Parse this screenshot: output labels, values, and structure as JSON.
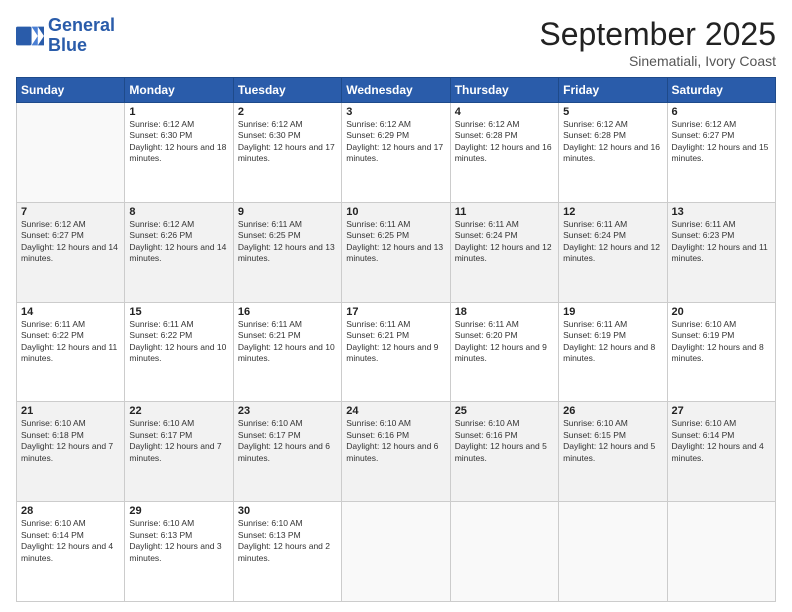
{
  "logo": {
    "line1": "General",
    "line2": "Blue"
  },
  "title": "September 2025",
  "location": "Sinematiali, Ivory Coast",
  "days_header": [
    "Sunday",
    "Monday",
    "Tuesday",
    "Wednesday",
    "Thursday",
    "Friday",
    "Saturday"
  ],
  "weeks": [
    [
      {
        "day": "",
        "sunrise": "",
        "sunset": "",
        "daylight": ""
      },
      {
        "day": "1",
        "sunrise": "Sunrise: 6:12 AM",
        "sunset": "Sunset: 6:30 PM",
        "daylight": "Daylight: 12 hours and 18 minutes."
      },
      {
        "day": "2",
        "sunrise": "Sunrise: 6:12 AM",
        "sunset": "Sunset: 6:30 PM",
        "daylight": "Daylight: 12 hours and 17 minutes."
      },
      {
        "day": "3",
        "sunrise": "Sunrise: 6:12 AM",
        "sunset": "Sunset: 6:29 PM",
        "daylight": "Daylight: 12 hours and 17 minutes."
      },
      {
        "day": "4",
        "sunrise": "Sunrise: 6:12 AM",
        "sunset": "Sunset: 6:28 PM",
        "daylight": "Daylight: 12 hours and 16 minutes."
      },
      {
        "day": "5",
        "sunrise": "Sunrise: 6:12 AM",
        "sunset": "Sunset: 6:28 PM",
        "daylight": "Daylight: 12 hours and 16 minutes."
      },
      {
        "day": "6",
        "sunrise": "Sunrise: 6:12 AM",
        "sunset": "Sunset: 6:27 PM",
        "daylight": "Daylight: 12 hours and 15 minutes."
      }
    ],
    [
      {
        "day": "7",
        "sunrise": "Sunrise: 6:12 AM",
        "sunset": "Sunset: 6:27 PM",
        "daylight": "Daylight: 12 hours and 14 minutes."
      },
      {
        "day": "8",
        "sunrise": "Sunrise: 6:12 AM",
        "sunset": "Sunset: 6:26 PM",
        "daylight": "Daylight: 12 hours and 14 minutes."
      },
      {
        "day": "9",
        "sunrise": "Sunrise: 6:11 AM",
        "sunset": "Sunset: 6:25 PM",
        "daylight": "Daylight: 12 hours and 13 minutes."
      },
      {
        "day": "10",
        "sunrise": "Sunrise: 6:11 AM",
        "sunset": "Sunset: 6:25 PM",
        "daylight": "Daylight: 12 hours and 13 minutes."
      },
      {
        "day": "11",
        "sunrise": "Sunrise: 6:11 AM",
        "sunset": "Sunset: 6:24 PM",
        "daylight": "Daylight: 12 hours and 12 minutes."
      },
      {
        "day": "12",
        "sunrise": "Sunrise: 6:11 AM",
        "sunset": "Sunset: 6:24 PM",
        "daylight": "Daylight: 12 hours and 12 minutes."
      },
      {
        "day": "13",
        "sunrise": "Sunrise: 6:11 AM",
        "sunset": "Sunset: 6:23 PM",
        "daylight": "Daylight: 12 hours and 11 minutes."
      }
    ],
    [
      {
        "day": "14",
        "sunrise": "Sunrise: 6:11 AM",
        "sunset": "Sunset: 6:22 PM",
        "daylight": "Daylight: 12 hours and 11 minutes."
      },
      {
        "day": "15",
        "sunrise": "Sunrise: 6:11 AM",
        "sunset": "Sunset: 6:22 PM",
        "daylight": "Daylight: 12 hours and 10 minutes."
      },
      {
        "day": "16",
        "sunrise": "Sunrise: 6:11 AM",
        "sunset": "Sunset: 6:21 PM",
        "daylight": "Daylight: 12 hours and 10 minutes."
      },
      {
        "day": "17",
        "sunrise": "Sunrise: 6:11 AM",
        "sunset": "Sunset: 6:21 PM",
        "daylight": "Daylight: 12 hours and 9 minutes."
      },
      {
        "day": "18",
        "sunrise": "Sunrise: 6:11 AM",
        "sunset": "Sunset: 6:20 PM",
        "daylight": "Daylight: 12 hours and 9 minutes."
      },
      {
        "day": "19",
        "sunrise": "Sunrise: 6:11 AM",
        "sunset": "Sunset: 6:19 PM",
        "daylight": "Daylight: 12 hours and 8 minutes."
      },
      {
        "day": "20",
        "sunrise": "Sunrise: 6:10 AM",
        "sunset": "Sunset: 6:19 PM",
        "daylight": "Daylight: 12 hours and 8 minutes."
      }
    ],
    [
      {
        "day": "21",
        "sunrise": "Sunrise: 6:10 AM",
        "sunset": "Sunset: 6:18 PM",
        "daylight": "Daylight: 12 hours and 7 minutes."
      },
      {
        "day": "22",
        "sunrise": "Sunrise: 6:10 AM",
        "sunset": "Sunset: 6:17 PM",
        "daylight": "Daylight: 12 hours and 7 minutes."
      },
      {
        "day": "23",
        "sunrise": "Sunrise: 6:10 AM",
        "sunset": "Sunset: 6:17 PM",
        "daylight": "Daylight: 12 hours and 6 minutes."
      },
      {
        "day": "24",
        "sunrise": "Sunrise: 6:10 AM",
        "sunset": "Sunset: 6:16 PM",
        "daylight": "Daylight: 12 hours and 6 minutes."
      },
      {
        "day": "25",
        "sunrise": "Sunrise: 6:10 AM",
        "sunset": "Sunset: 6:16 PM",
        "daylight": "Daylight: 12 hours and 5 minutes."
      },
      {
        "day": "26",
        "sunrise": "Sunrise: 6:10 AM",
        "sunset": "Sunset: 6:15 PM",
        "daylight": "Daylight: 12 hours and 5 minutes."
      },
      {
        "day": "27",
        "sunrise": "Sunrise: 6:10 AM",
        "sunset": "Sunset: 6:14 PM",
        "daylight": "Daylight: 12 hours and 4 minutes."
      }
    ],
    [
      {
        "day": "28",
        "sunrise": "Sunrise: 6:10 AM",
        "sunset": "Sunset: 6:14 PM",
        "daylight": "Daylight: 12 hours and 4 minutes."
      },
      {
        "day": "29",
        "sunrise": "Sunrise: 6:10 AM",
        "sunset": "Sunset: 6:13 PM",
        "daylight": "Daylight: 12 hours and 3 minutes."
      },
      {
        "day": "30",
        "sunrise": "Sunrise: 6:10 AM",
        "sunset": "Sunset: 6:13 PM",
        "daylight": "Daylight: 12 hours and 2 minutes."
      },
      {
        "day": "",
        "sunrise": "",
        "sunset": "",
        "daylight": ""
      },
      {
        "day": "",
        "sunrise": "",
        "sunset": "",
        "daylight": ""
      },
      {
        "day": "",
        "sunrise": "",
        "sunset": "",
        "daylight": ""
      },
      {
        "day": "",
        "sunrise": "",
        "sunset": "",
        "daylight": ""
      }
    ]
  ]
}
